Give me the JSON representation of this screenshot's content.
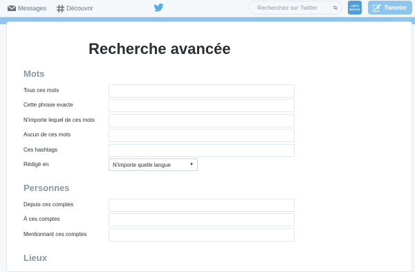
{
  "nav": {
    "messages_label": "Messages",
    "discover_label": "Découvrir",
    "search_placeholder": "Recherchez sur Twitter",
    "avatar_text": "LEPTI BOUTIK",
    "tweet_label": "Tweeter"
  },
  "page": {
    "title": "Recherche avancée"
  },
  "sections": {
    "words": {
      "title": "Mots",
      "fields": [
        {
          "label": "Tous ces mots",
          "value": ""
        },
        {
          "label": "Cette phrase exacte",
          "value": ""
        },
        {
          "label": "N'importe lequel de ces mots",
          "value": ""
        },
        {
          "label": "Aucun de ces mots",
          "value": ""
        },
        {
          "label": "Ces hashtags",
          "value": ""
        }
      ],
      "language_label": "Rédigé en",
      "language_value": "N'importe quelle langue"
    },
    "people": {
      "title": "Personnes",
      "fields": [
        {
          "label": "Depuis ces comptes",
          "value": ""
        },
        {
          "label": "À ces comptes",
          "value": ""
        },
        {
          "label": "Mentionnant ces comptes",
          "value": ""
        }
      ]
    },
    "places": {
      "title": "Lieux"
    }
  },
  "colors": {
    "accent": "#55acee",
    "stripe": "#8ec5ec",
    "section_title": "#8899a6",
    "text": "#292f33"
  },
  "icons": {
    "messages": "envelope-icon",
    "discover": "hashtag-icon",
    "logo": "twitter-bird-icon",
    "search": "magnifier-icon",
    "tweet": "compose-icon"
  }
}
